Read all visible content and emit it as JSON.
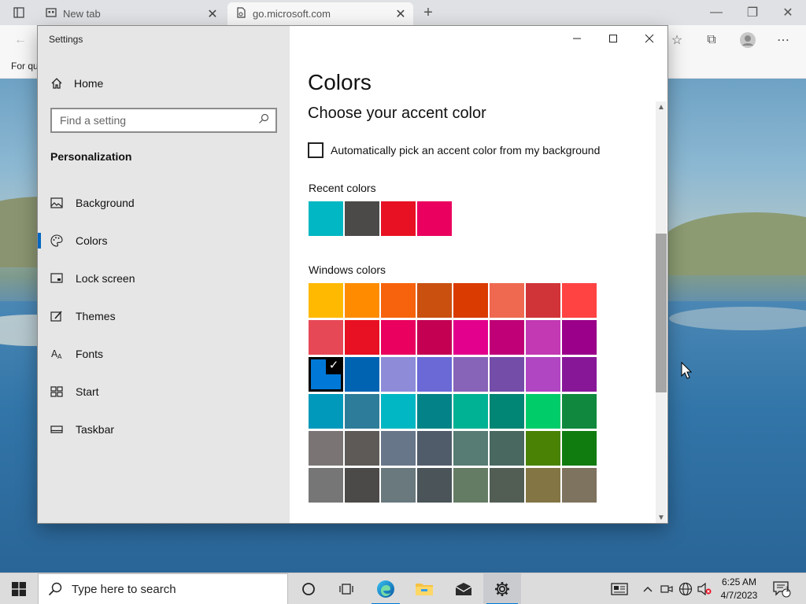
{
  "browser": {
    "tabs": [
      {
        "title": "New tab",
        "active": false
      },
      {
        "title": "go.microsoft.com",
        "active": true
      }
    ],
    "favorites_text": "For qu"
  },
  "settings": {
    "window_title": "Settings",
    "home_label": "Home",
    "search_placeholder": "Find a setting",
    "section": "Personalization",
    "nav_items": [
      {
        "label": "Background",
        "icon": "image-icon",
        "selected": false
      },
      {
        "label": "Colors",
        "icon": "palette-icon",
        "selected": true
      },
      {
        "label": "Lock screen",
        "icon": "lock-screen-icon",
        "selected": false
      },
      {
        "label": "Themes",
        "icon": "themes-icon",
        "selected": false
      },
      {
        "label": "Fonts",
        "icon": "fonts-icon",
        "selected": false
      },
      {
        "label": "Start",
        "icon": "start-icon",
        "selected": false
      },
      {
        "label": "Taskbar",
        "icon": "taskbar-icon",
        "selected": false
      }
    ],
    "page_title": "Colors",
    "accent_heading": "Choose your accent color",
    "auto_accent_label": "Automatically pick an accent color from my background",
    "auto_accent_checked": false,
    "recent_label": "Recent colors",
    "recent_colors": [
      "#00b7c3",
      "#4c4a48",
      "#e81123",
      "#ea005e"
    ],
    "windows_label": "Windows colors",
    "windows_colors": [
      [
        "#ffb900",
        "#ff8c00",
        "#f7630c",
        "#ca5010",
        "#da3b01",
        "#ef6950",
        "#d13438",
        "#ff4343"
      ],
      [
        "#e74856",
        "#e81123",
        "#ea005e",
        "#c30052",
        "#e3008c",
        "#bf0077",
        "#c239b3",
        "#9a0089"
      ],
      [
        "#0078d7",
        "#0063b1",
        "#8e8cd8",
        "#6b69d6",
        "#8764b8",
        "#744da9",
        "#b146c2",
        "#881798"
      ],
      [
        "#0099bc",
        "#2d7d9a",
        "#00b7c3",
        "#038387",
        "#00b294",
        "#018574",
        "#00cc6a",
        "#10893e"
      ],
      [
        "#7a7574",
        "#5d5a58",
        "#68768a",
        "#515c6b",
        "#567c73",
        "#486860",
        "#498205",
        "#107c10"
      ],
      [
        "#767676",
        "#4c4a48",
        "#69797e",
        "#4a5459",
        "#647c64",
        "#525e54",
        "#847545",
        "#7e735f"
      ]
    ],
    "selected_color": "#0078d7"
  },
  "taskbar": {
    "search_placeholder": "Type here to search",
    "time": "6:25 AM",
    "date": "4/7/2023",
    "notification_count": "1"
  }
}
